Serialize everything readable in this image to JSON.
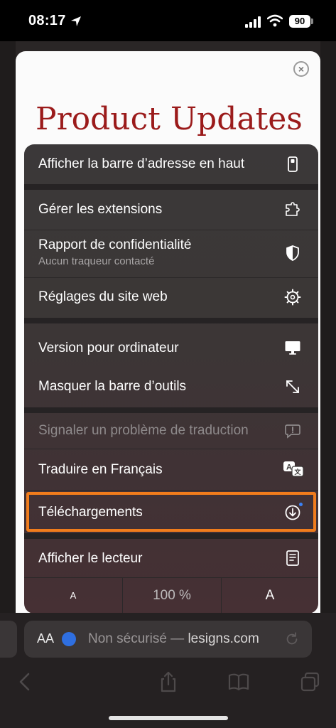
{
  "status_bar": {
    "time": "08:17",
    "battery": "90"
  },
  "page": {
    "title": "Product Updates",
    "close_glyph": "×"
  },
  "menu": {
    "items": [
      {
        "label": "Afficher la barre d’adresse en haut",
        "icon": "phone-address-bar-top-icon"
      },
      {
        "label": "Gérer les extensions",
        "icon": "puzzle-extensions-icon"
      },
      {
        "label": "Rapport de confidentialité",
        "sublabel": "Aucun traqueur contacté",
        "icon": "privacy-shield-icon"
      },
      {
        "label": "Réglages du site web",
        "icon": "gear-icon"
      },
      {
        "label": "Version pour ordinateur",
        "icon": "desktop-monitor-icon"
      },
      {
        "label": "Masquer la barre d’outils",
        "icon": "expand-arrows-icon"
      },
      {
        "label": "Signaler un problème de traduction",
        "icon": "report-bubble-icon",
        "disabled": true
      },
      {
        "label": "Traduire en Français",
        "icon": "translate-icon"
      },
      {
        "label": "Téléchargements",
        "icon": "download-circle-icon",
        "highlighted": true
      },
      {
        "label": "Afficher le lecteur",
        "icon": "reader-icon"
      }
    ],
    "zoom": {
      "decrease": "A",
      "level": "100 %",
      "increase": "A"
    }
  },
  "address_bar": {
    "aa_label": "AA",
    "status": "Non sécurisé",
    "separator": " — ",
    "domain": "lesigns.com"
  },
  "colors": {
    "highlight": "#f07c1c",
    "title_red": "#9b1b1b",
    "accent_blue": "#2f6fe0"
  }
}
